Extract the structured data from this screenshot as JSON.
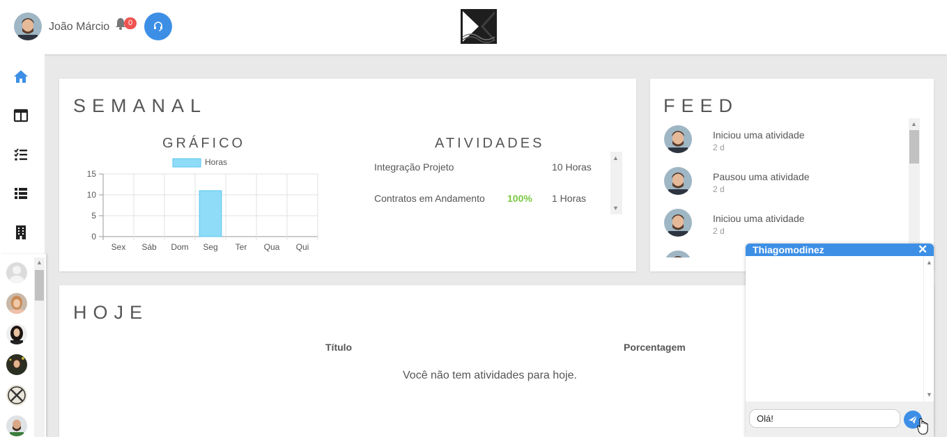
{
  "header": {
    "user_name": "João Márcio",
    "notification_count": "0",
    "accent_color": "#3d8fe6"
  },
  "sidebar": {
    "nav_items": [
      "home-icon",
      "dashboard-icon",
      "task-list-icon",
      "list-icon",
      "building-icon"
    ]
  },
  "weekly": {
    "title": "SEMANAL",
    "chart_title": "GRÁFICO",
    "activities_title": "ATIVIDADES",
    "activities": [
      {
        "name": "Integração Projeto",
        "percent": "",
        "hours": "10 Horas"
      },
      {
        "name": "Contratos em Andamento",
        "percent": "100%",
        "hours": "1 Horas"
      }
    ]
  },
  "chart_data": {
    "type": "bar",
    "categories": [
      "Sex",
      "Sáb",
      "Dom",
      "Seg",
      "Ter",
      "Qua",
      "Qui"
    ],
    "series": [
      {
        "name": "Horas",
        "values": [
          0,
          0,
          0,
          11,
          0,
          0,
          0
        ]
      }
    ],
    "y_ticks": [
      "0",
      "5",
      "10",
      "15"
    ],
    "ylim": [
      0,
      15
    ],
    "grid": true,
    "legend": "top",
    "colors": {
      "fill": "#8fdcf8",
      "stroke": "#59c5f0"
    }
  },
  "feed": {
    "title": "FEED",
    "items": [
      {
        "text": "Iniciou uma atividade",
        "time": "2 d"
      },
      {
        "text": "Pausou uma atividade",
        "time": "2 d"
      },
      {
        "text": "Iniciou uma atividade",
        "time": "2 d"
      }
    ]
  },
  "today": {
    "title": "HOJE",
    "col_title": "Título",
    "col_percent": "Porcentagem",
    "empty_message": "Você não tem atividades para hoje."
  },
  "chat": {
    "contact_name": "Thiagomodinez",
    "close_label": "✕",
    "input_value": "Olá!"
  }
}
